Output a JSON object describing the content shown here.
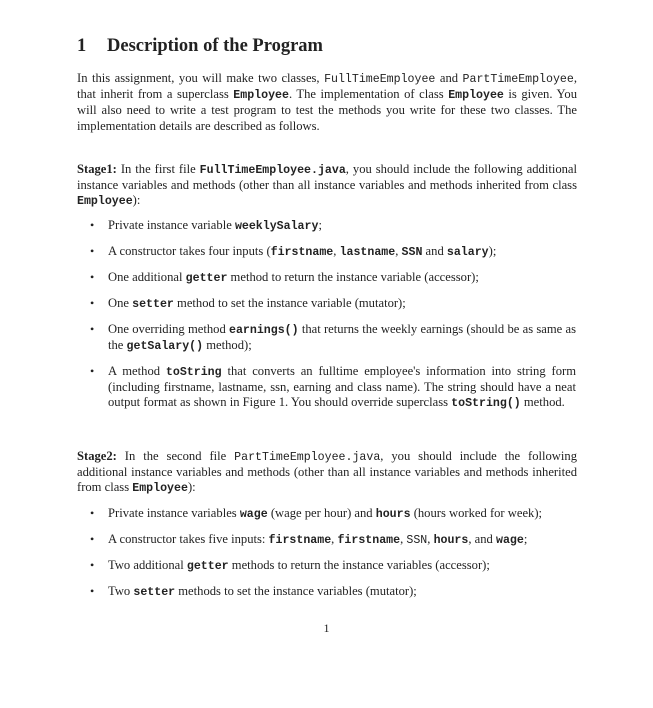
{
  "section": {
    "number": "1",
    "title": "Description of the Program"
  },
  "intro": {
    "t1": "In this assignment, you will make two classes, ",
    "c1": "FullTimeEmployee",
    "t2": " and ",
    "c2": "PartTimeEmployee",
    "t3": ", that inherit from a superclass ",
    "c3": "Employee",
    "t4": ". The implementation of class ",
    "c4": "Employee",
    "t5": " is given. You will also need to write a test program to test the methods you write for these two classes. The implementation details are described as follows."
  },
  "stage1": {
    "label": "Stage1:",
    "t1": " In the first file ",
    "c1": "FullTimeEmployee.java",
    "t2": ", you should include the following additional instance variables and methods (other than all instance variables and methods inherited from class ",
    "c2": "Employee",
    "t3": "):",
    "items": [
      {
        "t1": "Private instance variable ",
        "c1": "weeklySalary",
        "t2": ";"
      },
      {
        "t1": "A constructor takes four inputs (",
        "c1": "firstname",
        "t2": ", ",
        "c2": "lastname",
        "t3": ", ",
        "c3": "SSN",
        "t4": " and ",
        "c4": "salary",
        "t5": ");"
      },
      {
        "t1": "One additional ",
        "c1": "getter",
        "t2": " method to return the instance variable (accessor);"
      },
      {
        "t1": "One ",
        "c1": "setter",
        "t2": " method to set the instance variable (mutator);"
      },
      {
        "t1": "One overriding method ",
        "c1": "earnings()",
        "t2": " that returns the weekly earnings (should be as same as the ",
        "c2": "getSalary()",
        "t3": " method);"
      },
      {
        "t1": "A method ",
        "c1": "toString",
        "t2": " that converts an fulltime employee's information into string form (including firstname, lastname, ssn, earning and class name). The string should have a neat output format as shown in Figure 1. You should override superclass ",
        "c2": "toString()",
        "t3": " method."
      }
    ]
  },
  "stage2": {
    "label": "Stage2:",
    "t1": " In the second file ",
    "c1": "PartTimeEmployee.java",
    "t2": ", you should include the following additional instance variables and methods (other than all instance variables and methods inherited from class ",
    "c2": "Employee",
    "t3": "):",
    "items": [
      {
        "t1": "Private instance variables ",
        "c1": "wage",
        "t2": " (wage per hour) and ",
        "c2": "hours",
        "t3": " (hours worked for week);"
      },
      {
        "t1": "A constructor takes five inputs: ",
        "c1": "firstname",
        "t2": ", ",
        "c2": "firstname",
        "t3": ", ",
        "c3": "SSN",
        "t4": ", ",
        "c4": "hours",
        "t5": ", and ",
        "c5": "wage",
        "t6": ";"
      },
      {
        "t1": "Two additional ",
        "c1": "getter",
        "t2": " methods to return the instance variables (accessor);"
      },
      {
        "t1": "Two ",
        "c1": "setter",
        "t2": " methods to set the instance variables (mutator);"
      }
    ]
  },
  "footer": {
    "page_number": "1",
    "bullet_glyph": "•"
  }
}
